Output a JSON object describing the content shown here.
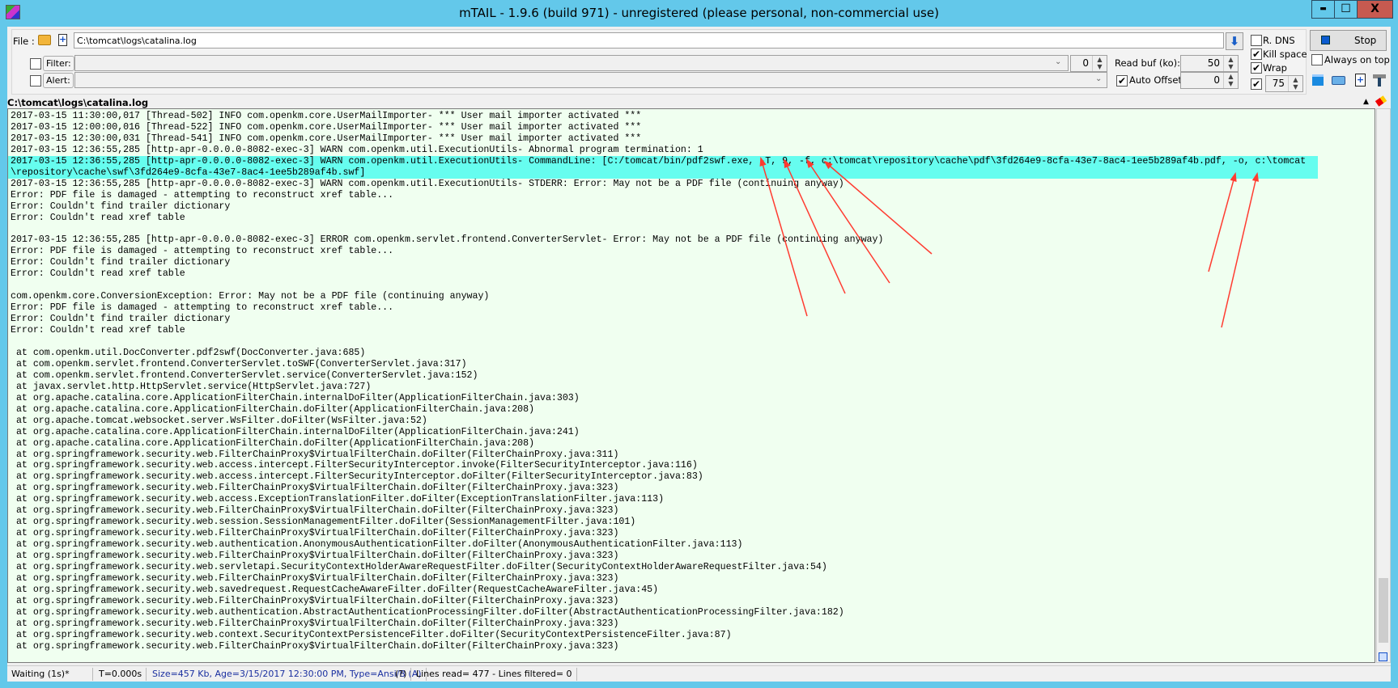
{
  "window": {
    "title": "mTAIL - 1.9.6 (build 971) - unregistered (please personal, non-commercial use)",
    "minimize": "▬",
    "maximize": "☐",
    "close": "X"
  },
  "toolbar": {
    "file_label": "File :",
    "file_value": "C:\\tomcat\\logs\\catalina.log",
    "filter_label": "Filter:",
    "filter_value": "",
    "filter_count": "0",
    "alert_label": "Alert:",
    "alert_value": "",
    "read_buf_label": "Read buf (ko):",
    "read_buf_value": "50",
    "auto_offset_label": "Auto Offset:",
    "auto_offset_checked": true,
    "auto_offset_value": "0",
    "rdns_label": "R. DNS",
    "rdns_checked": false,
    "kill_space_label": "Kill space",
    "kill_space_checked": true,
    "wrap_label": "Wrap",
    "wrap_checked": true,
    "extra_checked": true,
    "extra_value": "75",
    "stop_label": "Stop",
    "always_on_top_label": "Always on top",
    "always_on_top_checked": false
  },
  "path_label": "C:\\tomcat\\logs\\catalina.log",
  "highlight_color": "#66fdef",
  "annotation_color": "#ff3b30",
  "log_lines": [
    "2017-03-15 11:30:00,017 [Thread-502] INFO com.openkm.core.UserMailImporter- *** User mail importer activated ***",
    "2017-03-15 12:00:00,016 [Thread-522] INFO com.openkm.core.UserMailImporter- *** User mail importer activated ***",
    "2017-03-15 12:30:00,031 [Thread-541] INFO com.openkm.core.UserMailImporter- *** User mail importer activated ***",
    "2017-03-15 12:36:55,285 [http-apr-0.0.0.0-8082-exec-3] WARN com.openkm.util.ExecutionUtils- Abnormal program termination: 1",
    "2017-03-15 12:36:55,285 [http-apr-0.0.0.0-8082-exec-3] WARN com.openkm.util.ExecutionUtils- CommandLine: [C:/tomcat/bin/pdf2swf.exe, -T, 9, -f, c:\\tomcat\\repository\\cache\\pdf\\3fd264e9-8cfa-43e7-8ac4-1ee5b289af4b.pdf, -o, c:\\tomcat",
    "\\repository\\cache\\swf\\3fd264e9-8cfa-43e7-8ac4-1ee5b289af4b.swf]",
    "2017-03-15 12:36:55,285 [http-apr-0.0.0.0-8082-exec-3] WARN com.openkm.util.ExecutionUtils- STDERR: Error: May not be a PDF file (continuing anyway)",
    "Error: PDF file is damaged - attempting to reconstruct xref table...",
    "Error: Couldn't find trailer dictionary",
    "Error: Couldn't read xref table",
    "",
    "2017-03-15 12:36:55,285 [http-apr-0.0.0.0-8082-exec-3] ERROR com.openkm.servlet.frontend.ConverterServlet- Error: May not be a PDF file (continuing anyway)",
    "Error: PDF file is damaged - attempting to reconstruct xref table...",
    "Error: Couldn't find trailer dictionary",
    "Error: Couldn't read xref table",
    "",
    "com.openkm.core.ConversionException: Error: May not be a PDF file (continuing anyway)",
    "Error: PDF file is damaged - attempting to reconstruct xref table...",
    "Error: Couldn't find trailer dictionary",
    "Error: Couldn't read xref table",
    "",
    " at com.openkm.util.DocConverter.pdf2swf(DocConverter.java:685)",
    " at com.openkm.servlet.frontend.ConverterServlet.toSWF(ConverterServlet.java:317)",
    " at com.openkm.servlet.frontend.ConverterServlet.service(ConverterServlet.java:152)",
    " at javax.servlet.http.HttpServlet.service(HttpServlet.java:727)",
    " at org.apache.catalina.core.ApplicationFilterChain.internalDoFilter(ApplicationFilterChain.java:303)",
    " at org.apache.catalina.core.ApplicationFilterChain.doFilter(ApplicationFilterChain.java:208)",
    " at org.apache.tomcat.websocket.server.WsFilter.doFilter(WsFilter.java:52)",
    " at org.apache.catalina.core.ApplicationFilterChain.internalDoFilter(ApplicationFilterChain.java:241)",
    " at org.apache.catalina.core.ApplicationFilterChain.doFilter(ApplicationFilterChain.java:208)",
    " at org.springframework.security.web.FilterChainProxy$VirtualFilterChain.doFilter(FilterChainProxy.java:311)",
    " at org.springframework.security.web.access.intercept.FilterSecurityInterceptor.invoke(FilterSecurityInterceptor.java:116)",
    " at org.springframework.security.web.access.intercept.FilterSecurityInterceptor.doFilter(FilterSecurityInterceptor.java:83)",
    " at org.springframework.security.web.FilterChainProxy$VirtualFilterChain.doFilter(FilterChainProxy.java:323)",
    " at org.springframework.security.web.access.ExceptionTranslationFilter.doFilter(ExceptionTranslationFilter.java:113)",
    " at org.springframework.security.web.FilterChainProxy$VirtualFilterChain.doFilter(FilterChainProxy.java:323)",
    " at org.springframework.security.web.session.SessionManagementFilter.doFilter(SessionManagementFilter.java:101)",
    " at org.springframework.security.web.FilterChainProxy$VirtualFilterChain.doFilter(FilterChainProxy.java:323)",
    " at org.springframework.security.web.authentication.AnonymousAuthenticationFilter.doFilter(AnonymousAuthenticationFilter.java:113)",
    " at org.springframework.security.web.FilterChainProxy$VirtualFilterChain.doFilter(FilterChainProxy.java:323)",
    " at org.springframework.security.web.servletapi.SecurityContextHolderAwareRequestFilter.doFilter(SecurityContextHolderAwareRequestFilter.java:54)",
    " at org.springframework.security.web.FilterChainProxy$VirtualFilterChain.doFilter(FilterChainProxy.java:323)",
    " at org.springframework.security.web.savedrequest.RequestCacheAwareFilter.doFilter(RequestCacheAwareFilter.java:45)",
    " at org.springframework.security.web.FilterChainProxy$VirtualFilterChain.doFilter(FilterChainProxy.java:323)",
    " at org.springframework.security.web.authentication.AbstractAuthenticationProcessingFilter.doFilter(AbstractAuthenticationProcessingFilter.java:182)",
    " at org.springframework.security.web.FilterChainProxy$VirtualFilterChain.doFilter(FilterChainProxy.java:323)",
    " at org.springframework.security.web.context.SecurityContextPersistenceFilter.doFilter(SecurityContextPersistenceFilter.java:87)",
    " at org.springframework.security.web.FilterChainProxy$VirtualFilterChain.doFilter(FilterChainProxy.java:323)"
  ],
  "highlighted_lines": [
    4,
    5
  ],
  "status": {
    "state": "Waiting (1s)*",
    "time": "T=0.000s",
    "file_info": "Size=457 Kb, Age=3/15/2017 12:30:00 PM, Type=Ansi/B (A)",
    "help": "(?)",
    "lines": "Lines read= 477 - Lines filtered= 0"
  }
}
